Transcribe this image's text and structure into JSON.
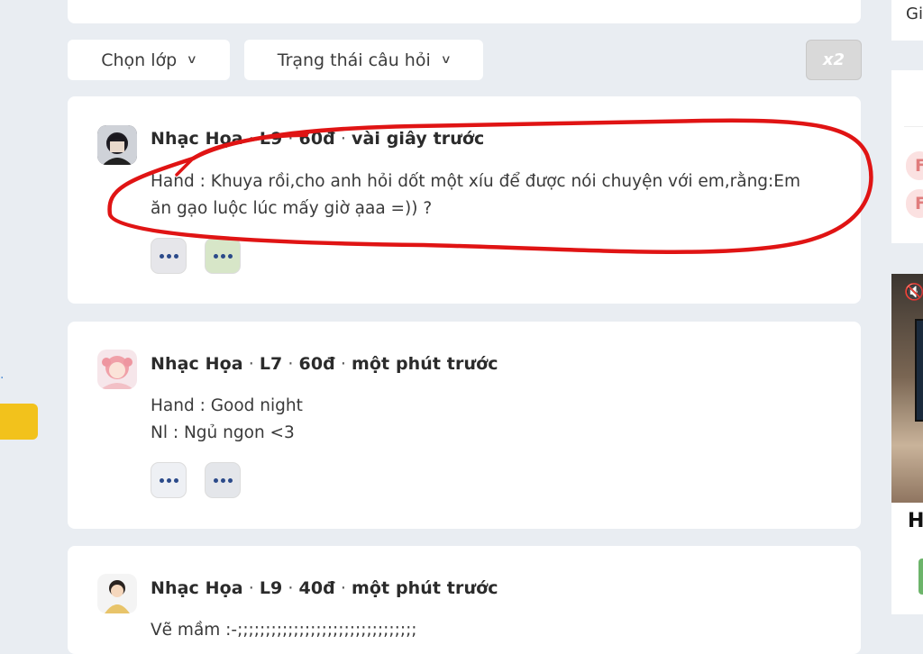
{
  "filters": {
    "class_label": "Chọn lớp",
    "status_label": "Trạng thái câu hỏi",
    "x2_label": "x2"
  },
  "posts": [
    {
      "author": "Nhạc Họa",
      "level": "L9",
      "points": "60đ",
      "time": "vài giây trước",
      "lines": [
        "Hand : Khuya rồi,cho anh hỏi dốt một xíu để được nói chuyện với em,rằng:Em",
        "ăn gạo luộc lúc mấy giờ ạaa =)) ?"
      ]
    },
    {
      "author": "Nhạc Họa",
      "level": "L7",
      "points": "60đ",
      "time": "một phút trước",
      "lines": [
        "Hand : Good night",
        "Nl : Ngủ ngon <3"
      ]
    },
    {
      "author": "Nhạc Họa",
      "level": "L9",
      "points": "40đ",
      "time": "một phút trước",
      "lines": [
        "Vẽ mầm :-;;;;;;;;;;;;;;;;;;;;;;;;;;;;;;;;"
      ]
    }
  ],
  "sidebar": {
    "top_text": "Gi",
    "pill_letter": "F",
    "video_heading_letter": "H"
  },
  "colors": {
    "background": "#e9edf2",
    "card": "#ffffff",
    "annotation_red": "#e01414",
    "accent_yellow": "#f2c21c",
    "pill_bg": "#fbe1e1"
  }
}
